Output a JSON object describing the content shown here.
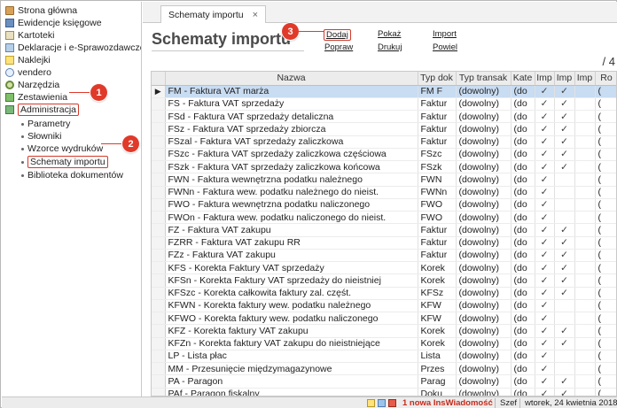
{
  "sidebar": {
    "items": [
      {
        "label": "Strona główna",
        "icon": "house-icon"
      },
      {
        "label": "Ewidencje księgowe",
        "icon": "ledger-icon"
      },
      {
        "label": "Kartoteki",
        "icon": "card-icon"
      },
      {
        "label": "Deklaracje i e-Sprawozdawczość",
        "icon": "declaration-icon"
      },
      {
        "label": "Naklejki",
        "icon": "sticker-icon"
      },
      {
        "label": "vendero",
        "icon": "vendero-icon"
      },
      {
        "label": "Narzędzia",
        "icon": "gear-icon"
      },
      {
        "label": "Zestawienia",
        "icon": "chart-icon"
      },
      {
        "label": "Administracja",
        "icon": "admin-icon"
      }
    ],
    "subitems": [
      {
        "label": "Parametry"
      },
      {
        "label": "Słowniki"
      },
      {
        "label": "Wzorce wydruków"
      },
      {
        "label": "Schematy importu"
      },
      {
        "label": "Biblioteka dokumentów"
      }
    ]
  },
  "callouts": {
    "one": "1",
    "two": "2",
    "three": "3"
  },
  "tab": {
    "label": "Schematy importu",
    "close": "×"
  },
  "page": {
    "title": "Schematy importu",
    "counter": "/ 4"
  },
  "actions": {
    "add": "Dodaj",
    "show": "Pokaż",
    "import": "Import",
    "fix": "Popraw",
    "print": "Drukuj",
    "repeat": "Powiel"
  },
  "table": {
    "columns": [
      "Nazwa",
      "Typ dok",
      "Typ transak",
      "Kate",
      "Imp",
      "Imp",
      "Imp",
      "Ro"
    ],
    "rows": [
      {
        "name": "FM - Faktura VAT marża",
        "type": "FM F",
        "trans": "(dowolny)",
        "cat": "(do",
        "i1": "✓",
        "i2": "✓",
        "i3": "",
        "ro": "("
      },
      {
        "name": "FS - Faktura VAT sprzedaży",
        "type": "Faktur",
        "trans": "(dowolny)",
        "cat": "(do",
        "i1": "✓",
        "i2": "✓",
        "i3": "",
        "ro": "("
      },
      {
        "name": "FSd - Faktura VAT sprzedaży detaliczna",
        "type": "Faktur",
        "trans": "(dowolny)",
        "cat": "(do",
        "i1": "✓",
        "i2": "✓",
        "i3": "",
        "ro": "("
      },
      {
        "name": "FSz - Faktura VAT sprzedaży zbiorcza",
        "type": "Faktur",
        "trans": "(dowolny)",
        "cat": "(do",
        "i1": "✓",
        "i2": "✓",
        "i3": "",
        "ro": "("
      },
      {
        "name": "FSzal - Faktura VAT sprzedaży zaliczkowa",
        "type": "Faktur",
        "trans": "(dowolny)",
        "cat": "(do",
        "i1": "✓",
        "i2": "✓",
        "i3": "",
        "ro": "("
      },
      {
        "name": "FSzc - Faktura VAT sprzedaży zaliczkowa częściowa",
        "type": "FSzc",
        "trans": "(dowolny)",
        "cat": "(do",
        "i1": "✓",
        "i2": "✓",
        "i3": "",
        "ro": "("
      },
      {
        "name": "FSzk - Faktura VAT sprzedaży zaliczkowa końcowa",
        "type": "FSzk",
        "trans": "(dowolny)",
        "cat": "(do",
        "i1": "✓",
        "i2": "✓",
        "i3": "",
        "ro": "("
      },
      {
        "name": "FWN - Faktura wewnętrzna podatku należnego",
        "type": "FWN",
        "trans": "(dowolny)",
        "cat": "(do",
        "i1": "✓",
        "i2": "",
        "i3": "",
        "ro": "("
      },
      {
        "name": "FWNn - Faktura wew. podatku należnego do nieist.",
        "type": "FWNn",
        "trans": "(dowolny)",
        "cat": "(do",
        "i1": "✓",
        "i2": "",
        "i3": "",
        "ro": "("
      },
      {
        "name": "FWO - Faktura wewnętrzna podatku naliczonego",
        "type": "FWO",
        "trans": "(dowolny)",
        "cat": "(do",
        "i1": "✓",
        "i2": "",
        "i3": "",
        "ro": "("
      },
      {
        "name": "FWOn - Faktura wew. podatku naliczonego do nieist.",
        "type": "FWO",
        "trans": "(dowolny)",
        "cat": "(do",
        "i1": "✓",
        "i2": "",
        "i3": "",
        "ro": "("
      },
      {
        "name": "FZ - Faktura VAT zakupu",
        "type": "Faktur",
        "trans": "(dowolny)",
        "cat": "(do",
        "i1": "✓",
        "i2": "✓",
        "i3": "",
        "ro": "("
      },
      {
        "name": "FZRR - Faktura VAT zakupu RR",
        "type": "Faktur",
        "trans": "(dowolny)",
        "cat": "(do",
        "i1": "✓",
        "i2": "✓",
        "i3": "",
        "ro": "("
      },
      {
        "name": "FZz - Faktura VAT zakupu",
        "type": "Faktur",
        "trans": "(dowolny)",
        "cat": "(do",
        "i1": "✓",
        "i2": "✓",
        "i3": "",
        "ro": "("
      },
      {
        "name": "KFS - Korekta Faktury VAT sprzedaży",
        "type": "Korek",
        "trans": "(dowolny)",
        "cat": "(do",
        "i1": "✓",
        "i2": "✓",
        "i3": "",
        "ro": "("
      },
      {
        "name": "KFSn - Korekta Faktury VAT sprzedaży do nieistniej",
        "type": "Korek",
        "trans": "(dowolny)",
        "cat": "(do",
        "i1": "✓",
        "i2": "✓",
        "i3": "",
        "ro": "("
      },
      {
        "name": "KFSzc - Korekta całkowita faktury zal. częśt.",
        "type": "KFSz",
        "trans": "(dowolny)",
        "cat": "(do",
        "i1": "✓",
        "i2": "✓",
        "i3": "",
        "ro": "("
      },
      {
        "name": "KFWN - Korekta faktury wew. podatku należnego",
        "type": "KFW",
        "trans": "(dowolny)",
        "cat": "(do",
        "i1": "✓",
        "i2": "",
        "i3": "",
        "ro": "("
      },
      {
        "name": "KFWO - Korekta faktury wew. podatku naliczonego",
        "type": "KFW",
        "trans": "(dowolny)",
        "cat": "(do",
        "i1": "✓",
        "i2": "",
        "i3": "",
        "ro": "("
      },
      {
        "name": "KFZ - Korekta faktury VAT zakupu",
        "type": "Korek",
        "trans": "(dowolny)",
        "cat": "(do",
        "i1": "✓",
        "i2": "✓",
        "i3": "",
        "ro": "("
      },
      {
        "name": "KFZn - Korekta faktury VAT zakupu do nieistniejące",
        "type": "Korek",
        "trans": "(dowolny)",
        "cat": "(do",
        "i1": "✓",
        "i2": "✓",
        "i3": "",
        "ro": "("
      },
      {
        "name": "LP - Lista płac",
        "type": "Lista",
        "trans": "(dowolny)",
        "cat": "(do",
        "i1": "✓",
        "i2": "",
        "i3": "",
        "ro": "("
      },
      {
        "name": "MM - Przesunięcie międzymagazynowe",
        "type": "Przes",
        "trans": "(dowolny)",
        "cat": "(do",
        "i1": "✓",
        "i2": "",
        "i3": "",
        "ro": "("
      },
      {
        "name": "PA - Paragon",
        "type": "Parag",
        "trans": "(dowolny)",
        "cat": "(do",
        "i1": "✓",
        "i2": "✓",
        "i3": "",
        "ro": "("
      },
      {
        "name": "PAf - Paragon fiskalny",
        "type": "Doku",
        "trans": "(dowolny)",
        "cat": "(do",
        "i1": "✓",
        "i2": "✓",
        "i3": "",
        "ro": "("
      }
    ]
  },
  "status": {
    "notification": "1 nowa InsWiadomość",
    "user": "Szef",
    "date": "wtorek, 24 kwietnia 2018"
  }
}
